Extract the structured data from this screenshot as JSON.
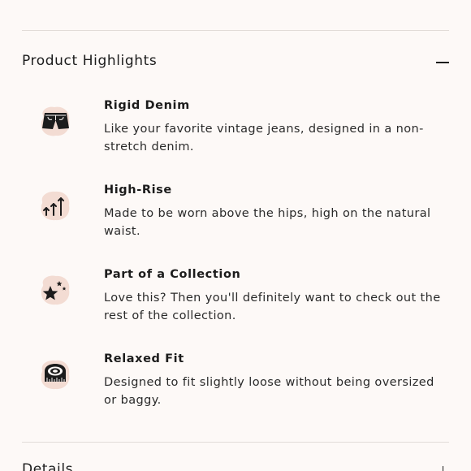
{
  "section": {
    "title": "Product Highlights",
    "toggle_icon": "minus-icon"
  },
  "features": [
    {
      "icon": "denim-shorts-icon",
      "title": "Rigid Denim",
      "description": "Like your favorite vintage jeans, designed in a non-stretch denim."
    },
    {
      "icon": "up-arrows-icon",
      "title": "High-Rise",
      "description": "Made to be worn above the hips, high on the natural waist."
    },
    {
      "icon": "stars-icon",
      "title": "Part of a Collection",
      "description": "Love this? Then you'll definitely want to check out the rest of the collection."
    },
    {
      "icon": "measuring-tape-icon",
      "title": "Relaxed Fit",
      "description": "Designed to fit slightly loose without being oversized or baggy."
    }
  ],
  "next_section": {
    "title": "Details",
    "toggle_icon": "plus-icon"
  },
  "colors": {
    "background": "#fdf9f7",
    "icon_blob": "#f3dcd3",
    "text": "#1c1c1c",
    "divider": "#e2dcd8"
  }
}
